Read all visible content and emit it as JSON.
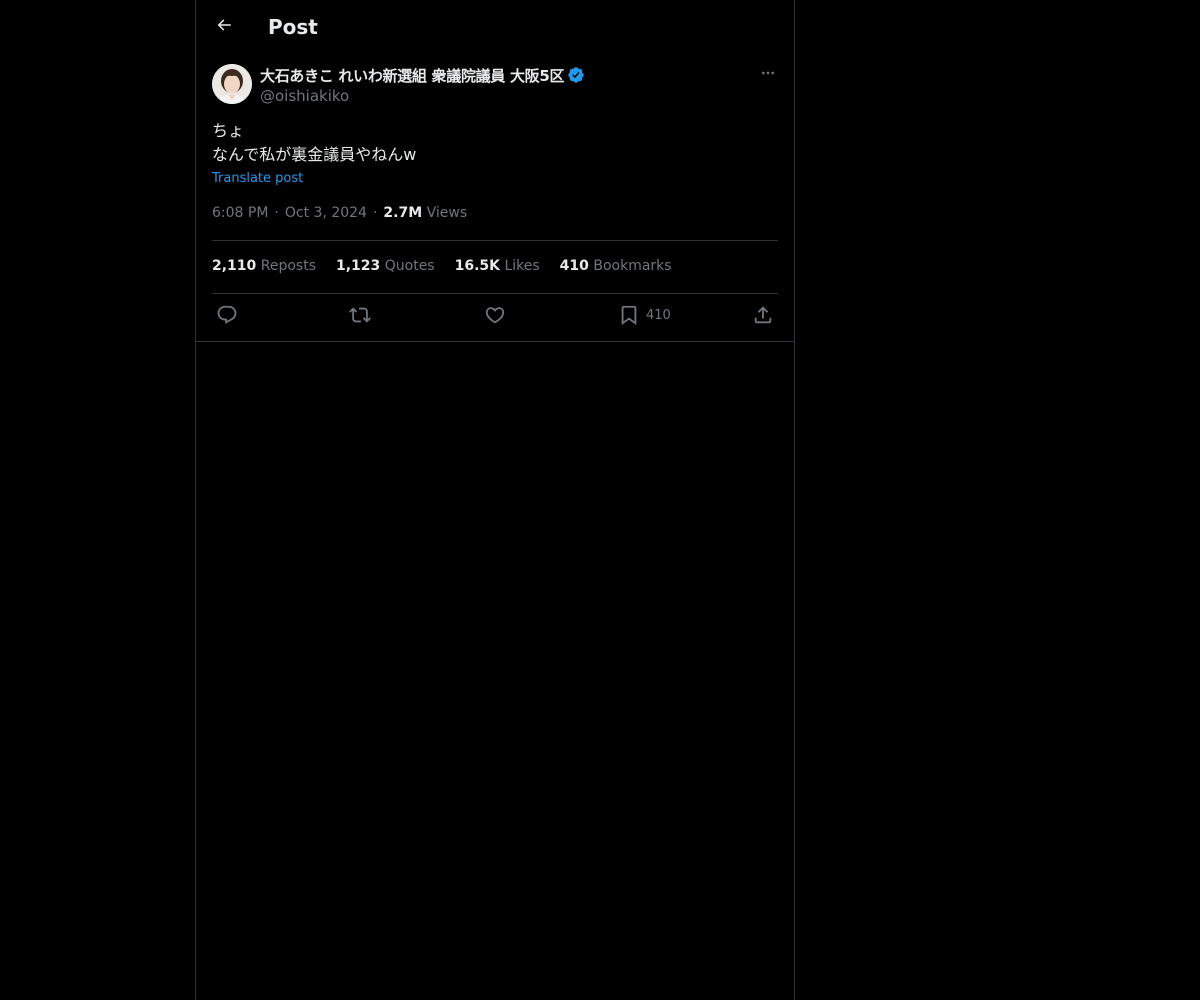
{
  "header": {
    "title": "Post",
    "back_icon": "arrow-left-icon"
  },
  "post": {
    "author": {
      "display_name": "大石あきこ れいわ新選組 衆議院議員 大阪5区",
      "handle": "@oishiakiko",
      "verified": true,
      "verified_color": "#1d9bf0"
    },
    "text": "ちょ\nなんで私が裏金議員やねんw",
    "translate_label": "Translate post",
    "time": "6:08 PM",
    "date": "Oct 3, 2024",
    "views_count": "2.7M",
    "views_label": "Views",
    "stats": {
      "reposts_count": "2,110",
      "reposts_label": "Reposts",
      "quotes_count": "1,123",
      "quotes_label": "Quotes",
      "likes_count": "16.5K",
      "likes_label": "Likes",
      "bookmarks_count": "410",
      "bookmarks_label": "Bookmarks"
    },
    "actions": {
      "reply_icon": "reply-icon",
      "repost_icon": "repost-icon",
      "like_icon": "heart-icon",
      "bookmark_icon": "bookmark-icon",
      "bookmark_count": "410",
      "share_icon": "share-icon"
    }
  },
  "colors": {
    "background": "#000000",
    "text_primary": "#e7e9ea",
    "text_secondary": "#71767b",
    "accent": "#1d9bf0",
    "border": "#2f3336"
  }
}
